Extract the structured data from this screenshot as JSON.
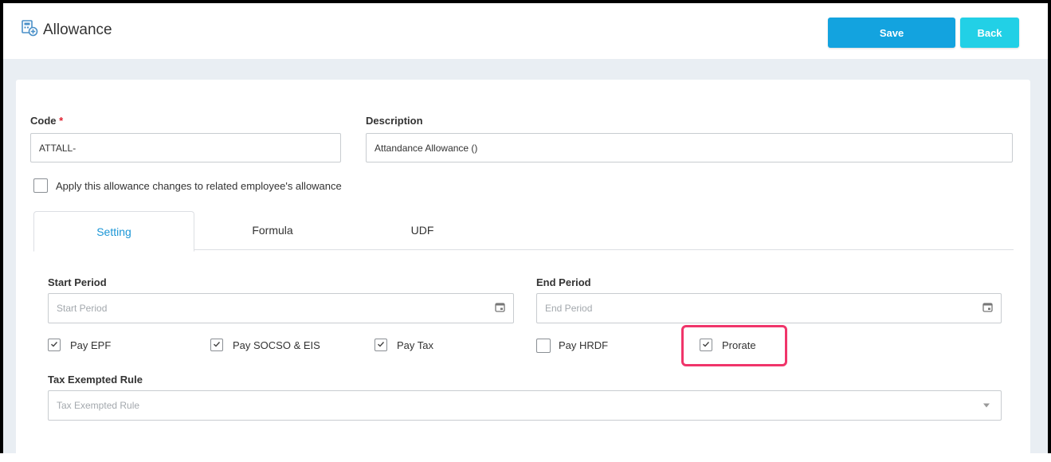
{
  "header": {
    "title": "Allowance",
    "icon": "calculator-add-icon",
    "save_label": "Save",
    "back_label": "Back",
    "save_color": "#13a3df",
    "back_color": "#22d0e6"
  },
  "form": {
    "code": {
      "label": "Code",
      "required_mark": "*",
      "value": "ATTALL-"
    },
    "description": {
      "label": "Description",
      "value": "Attandance Allowance ()"
    },
    "apply_changes": {
      "label": "Apply this allowance changes to related employee's allowance",
      "checked": false
    }
  },
  "tabs": [
    {
      "label": "Setting",
      "active": true
    },
    {
      "label": "Formula",
      "active": false
    },
    {
      "label": "UDF",
      "active": false
    }
  ],
  "setting": {
    "start_period": {
      "label": "Start Period",
      "placeholder": "Start Period"
    },
    "end_period": {
      "label": "End Period",
      "placeholder": "End Period"
    },
    "checkboxes": [
      {
        "label": "Pay EPF",
        "checked": true
      },
      {
        "label": "Pay SOCSO & EIS",
        "checked": true
      },
      {
        "label": "Pay Tax",
        "checked": true
      },
      {
        "label": "Pay HRDF",
        "checked": false
      },
      {
        "label": "Prorate",
        "checked": true
      }
    ],
    "tax_exempted_rule": {
      "label": "Tax Exempted Rule",
      "placeholder": "Tax Exempted Rule"
    }
  },
  "highlight_color": "#f0356a"
}
